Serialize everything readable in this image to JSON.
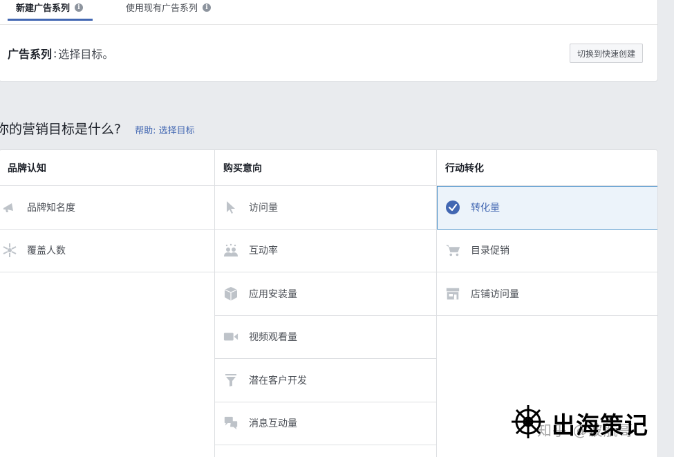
{
  "tabs": [
    {
      "label": "新建广告系列",
      "active": true,
      "icon": "info-icon"
    },
    {
      "label": "使用现有广告系列",
      "active": false,
      "icon": "info-icon"
    }
  ],
  "campaign": {
    "label": "广告系列",
    "separator": ":",
    "value": "选择目标。",
    "switch_button": "切换到快速创建"
  },
  "question": {
    "text": "你的营销目标是什么?",
    "help_link": "帮助: 选择目标"
  },
  "columns": [
    {
      "header": "品牌认知",
      "items": [
        {
          "label": "品牌知名度",
          "icon": "megaphone-icon"
        },
        {
          "label": "覆盖人数",
          "icon": "reach-burst-icon"
        }
      ]
    },
    {
      "header": "购买意向",
      "items": [
        {
          "label": "访问量",
          "icon": "cursor-icon"
        },
        {
          "label": "互动率",
          "icon": "people-icon"
        },
        {
          "label": "应用安装量",
          "icon": "box-icon"
        },
        {
          "label": "视频观看量",
          "icon": "video-camera-icon"
        },
        {
          "label": "潜在客户开发",
          "icon": "funnel-icon"
        },
        {
          "label": "消息互动量",
          "icon": "chat-bubbles-icon"
        }
      ]
    },
    {
      "header": "行动转化",
      "items": [
        {
          "label": "转化量",
          "icon": "check-circle-icon",
          "selected": true
        },
        {
          "label": "目录促销",
          "icon": "shopping-cart-icon"
        },
        {
          "label": "店铺访问量",
          "icon": "store-icon"
        }
      ]
    }
  ],
  "watermark": {
    "title": "出海策记",
    "subtitle": "知乎 @波航哥",
    "icon": "ship-wheel-icon"
  },
  "colors": {
    "accent": "#4267b2",
    "selected_bg": "#ecf3fa",
    "selected_border": "#4a90c8",
    "icon_gray": "#bec3c9",
    "page_bg": "#e9ebee"
  }
}
